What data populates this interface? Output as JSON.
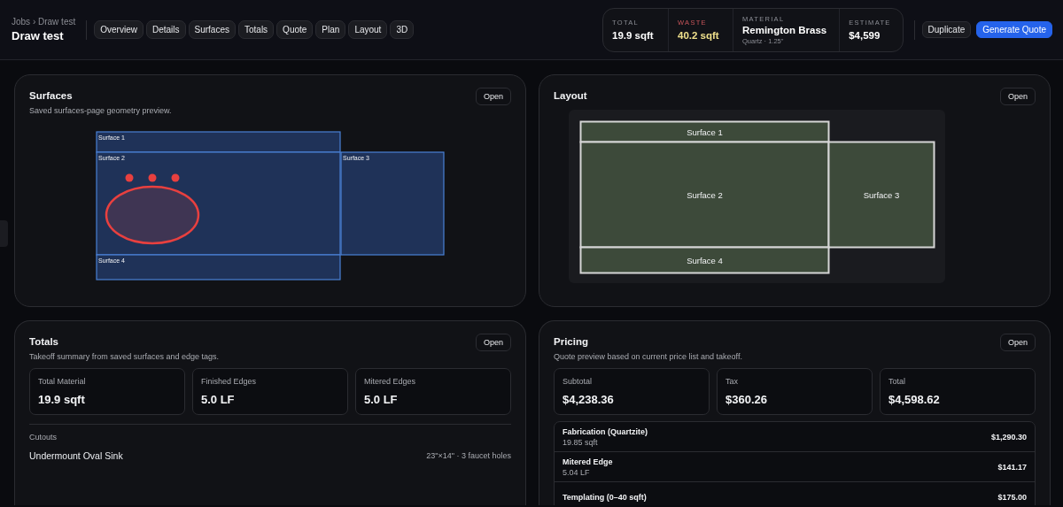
{
  "header": {
    "breadcrumb": "Jobs › Draw test",
    "title": "Draw test",
    "tabs": [
      {
        "label": "Overview",
        "selected": false
      },
      {
        "label": "Details",
        "selected": false
      },
      {
        "label": "Surfaces",
        "selected": false
      },
      {
        "label": "Totals",
        "selected": false
      },
      {
        "label": "Quote",
        "selected": false
      },
      {
        "label": "Plan",
        "selected": false
      },
      {
        "label": "Layout",
        "selected": false
      },
      {
        "label": "3D",
        "selected": false
      }
    ],
    "stats": [
      {
        "kind": "plain",
        "label": "TOTAL",
        "value": "19.9 sqft"
      },
      {
        "kind": "warning",
        "label": "WASTE",
        "value": "40.2 sqft"
      },
      {
        "kind": "material",
        "label": "MATERIAL",
        "value": "Remington Brass",
        "detail": "Quartz · 1.25\""
      },
      {
        "kind": "plain",
        "label": "ESTIMATE",
        "value": "$4,599"
      }
    ],
    "buttons": [
      {
        "label": "Duplicate",
        "kind": "secondary"
      },
      {
        "label": "Generate Quote",
        "kind": "primary"
      }
    ]
  },
  "surfaces_card": {
    "title": "Surfaces",
    "subtitle": "Saved surfaces-page geometry preview.",
    "button": "Open",
    "surfaces": [
      {
        "label": "Surface 1"
      },
      {
        "label": "Surface 2"
      },
      {
        "label": "Surface 3"
      },
      {
        "label": "Surface 4"
      }
    ]
  },
  "layout_card": {
    "title": "Layout",
    "button": "Open",
    "surfaces": [
      {
        "label": "Surface 1"
      },
      {
        "label": "Surface 2"
      },
      {
        "label": "Surface 3"
      },
      {
        "label": "Surface 4"
      }
    ]
  },
  "totals_card": {
    "title": "Totals",
    "subtitle": "Takeoff summary from saved surfaces and edge tags.",
    "button": "Open",
    "tiles": [
      {
        "label": "Total Material",
        "value": "19.9 sqft"
      },
      {
        "label": "Finished Edges",
        "value": "5.0 LF"
      },
      {
        "label": "Mitered Edges",
        "value": "5.0 LF"
      }
    ],
    "cutouts_label": "Cutouts",
    "cutouts": [
      {
        "name": "Undermount Oval Sink",
        "detail": "23\"×14\" · 3 faucet holes"
      }
    ]
  },
  "pricing_card": {
    "title": "Pricing",
    "subtitle": "Quote preview based on current price list and takeoff.",
    "button": "Open",
    "tiles": [
      {
        "label": "Subtotal",
        "value": "$4,238.36"
      },
      {
        "label": "Tax",
        "value": "$360.26"
      },
      {
        "label": "Total",
        "value": "$4,598.62"
      }
    ],
    "lines": [
      {
        "name": "Fabrication (Quartzite)",
        "detail": "19.85 sqft",
        "amount": "$1,290.30"
      },
      {
        "name": "Mitered Edge",
        "detail": "5.04 LF",
        "amount": "$141.17"
      },
      {
        "name": "Templating (0–40 sqft)",
        "amount": "$175.00"
      }
    ]
  }
}
